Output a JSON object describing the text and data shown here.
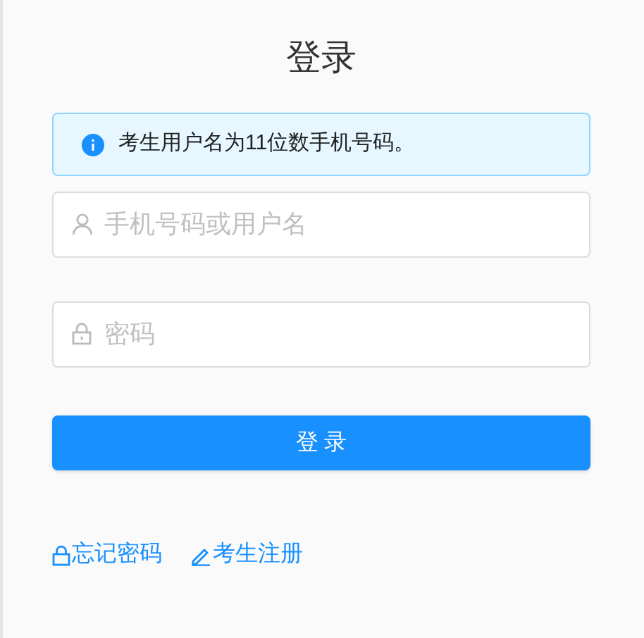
{
  "title": "登录",
  "alert": {
    "kind": "info",
    "text": "考生用户名为11位数手机号码。"
  },
  "fields": [
    {
      "kind": "user",
      "placeholder": "手机号码或用户名"
    },
    {
      "kind": "password",
      "placeholder": "密码"
    }
  ],
  "submit_button": "登 录",
  "links": [
    {
      "kind": "lock",
      "label": "忘记密码"
    },
    {
      "kind": "pen",
      "label": "考生注册"
    }
  ]
}
